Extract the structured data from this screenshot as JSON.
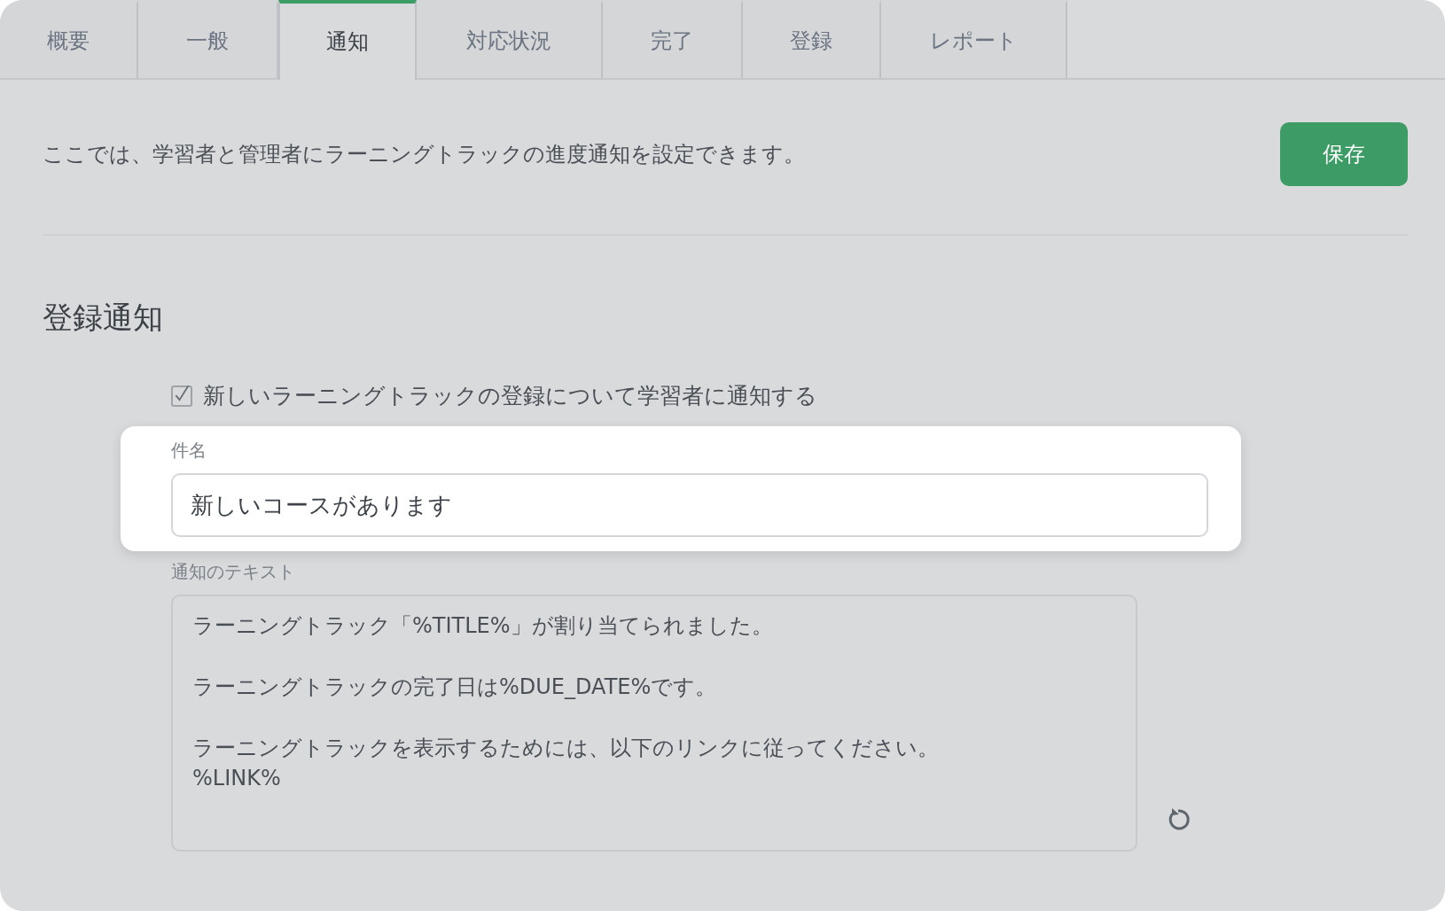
{
  "tabs": [
    {
      "label": "概要",
      "selected": false
    },
    {
      "label": "一般",
      "selected": false
    },
    {
      "label": "通知",
      "selected": true
    },
    {
      "label": "対応状況",
      "selected": false
    },
    {
      "label": "完了",
      "selected": false
    },
    {
      "label": "登録",
      "selected": false
    },
    {
      "label": "レポート",
      "selected": false
    }
  ],
  "intro": "ここでは、学習者と管理者にラーニングトラックの進度通知を設定できます。",
  "save_button": "保存",
  "section_title": "登録通知",
  "notify_checkbox": {
    "label": "新しいラーニングトラックの登録について学習者に通知する",
    "checked": true
  },
  "subject": {
    "label": "件名",
    "value": "新しいコースがあります"
  },
  "message": {
    "label": "通知のテキスト",
    "paragraphs": [
      [
        "ラーニングトラック「%TITLE%」が割り当てられました。"
      ],
      [
        "ラーニングトラックの完了日は%DUE_DATE%です。"
      ],
      [
        "ラーニングトラックを表示するためには、以下のリンクに従ってください。",
        "%LINK%"
      ]
    ]
  }
}
